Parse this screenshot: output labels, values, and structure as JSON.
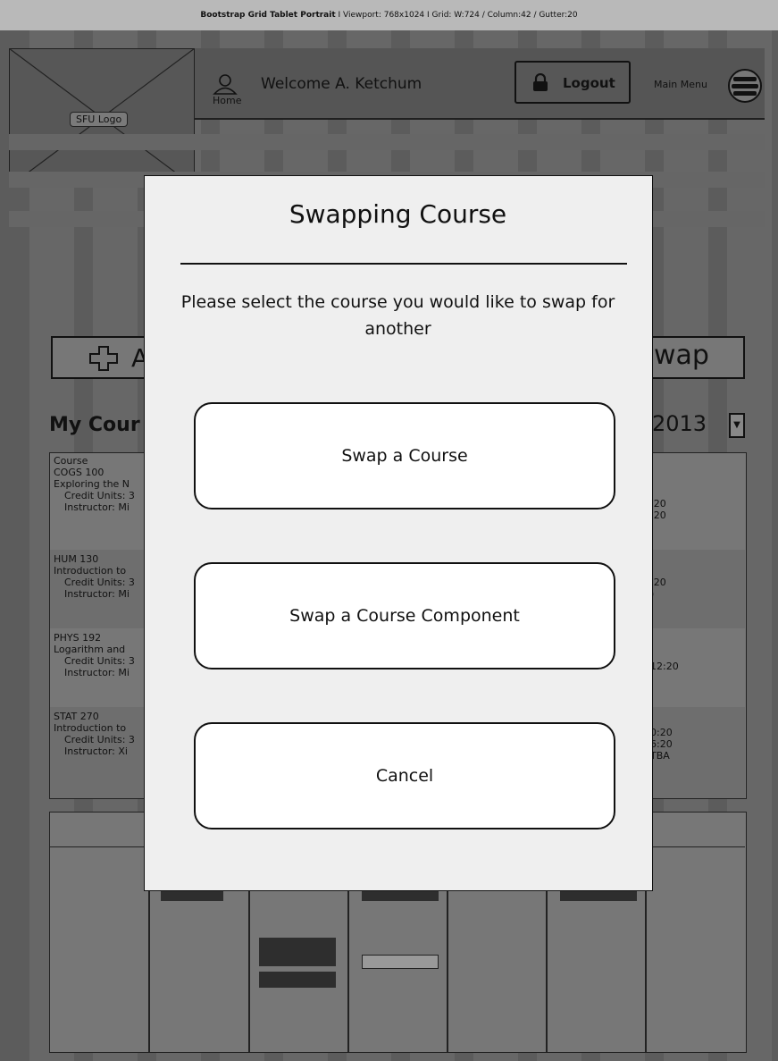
{
  "topbar": {
    "title": "Bootstrap Grid Tablet Portrait",
    "details": " I  Viewport: 768x1024  I  Grid: W:724 / Column:42 / Gutter:20"
  },
  "header": {
    "logo_label": "SFU Logo",
    "home_label": "Home",
    "welcome": "Welcome A. Ketchum",
    "logout_label": "Logout",
    "menu_label": "Main Menu"
  },
  "background": {
    "add_label": "A",
    "swap_label": "wap",
    "my_courses": "My Cour",
    "term_value": "2013",
    "rows": [
      {
        "lines": [
          "Course",
          "COGS 100",
          "Exploring the N",
          "Credit Units: 3",
          "Instructor: Mi"
        ],
        "right": [
          ":20",
          ":20"
        ]
      },
      {
        "lines": [
          "HUM 130",
          "Introduction to",
          "Credit Units: 3",
          "Instructor: Mi"
        ],
        "right": [
          ":20",
          ")"
        ]
      },
      {
        "lines": [
          "PHYS 192",
          "Logarithm and",
          "Credit Units: 3",
          "Instructor: Mi"
        ],
        "right": [
          "12:20"
        ]
      },
      {
        "lines": [
          "STAT 270",
          "Introduction to",
          "Credit Units: 3",
          "Instructor: Xi"
        ],
        "right": [
          "0:20",
          "6:20",
          "TBA"
        ]
      }
    ]
  },
  "modal": {
    "title": "Swapping Course",
    "message": "Please select the course you would like to swap for another",
    "buttons": {
      "swap_course": "Swap a Course",
      "swap_component": "Swap a Course Component",
      "cancel": "Cancel"
    }
  }
}
